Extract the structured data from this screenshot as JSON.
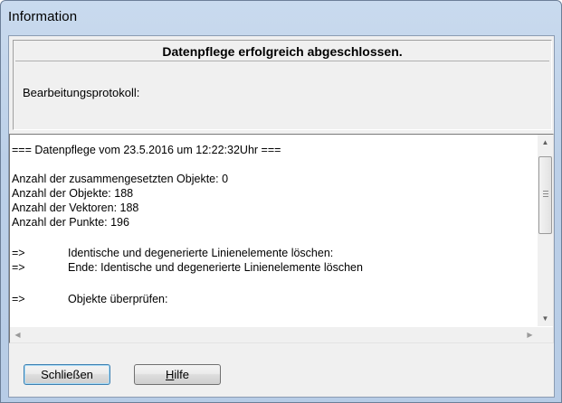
{
  "window": {
    "title": "Information"
  },
  "info_panel": {
    "headline": "Datenpflege erfolgreich abgeschlossen.",
    "protocol_label": "Bearbeitungsprotokoll:"
  },
  "log": {
    "lines": [
      "=== Datenpflege vom 23.5.2016 um 12:22:32Uhr ===",
      "",
      "Anzahl der zusammengesetzten Objekte: 0",
      "Anzahl der Objekte: 188",
      "Anzahl der Vektoren: 188",
      "Anzahl der Punkte: 196",
      "",
      "=>\tIdentische und degenerierte Linienelemente löschen:",
      "=>\tEnde: Identische und degenerierte Linienelemente löschen",
      "",
      "=>\tObjekte überprüfen:"
    ],
    "scroll_up_icon": "up-arrow-icon",
    "scroll_down_icon": "down-arrow-icon",
    "scroll_left_icon": "left-arrow-icon",
    "scroll_right_icon": "right-arrow-icon"
  },
  "buttons": {
    "close_label": "Schließen",
    "help_label": "Hilfe"
  }
}
